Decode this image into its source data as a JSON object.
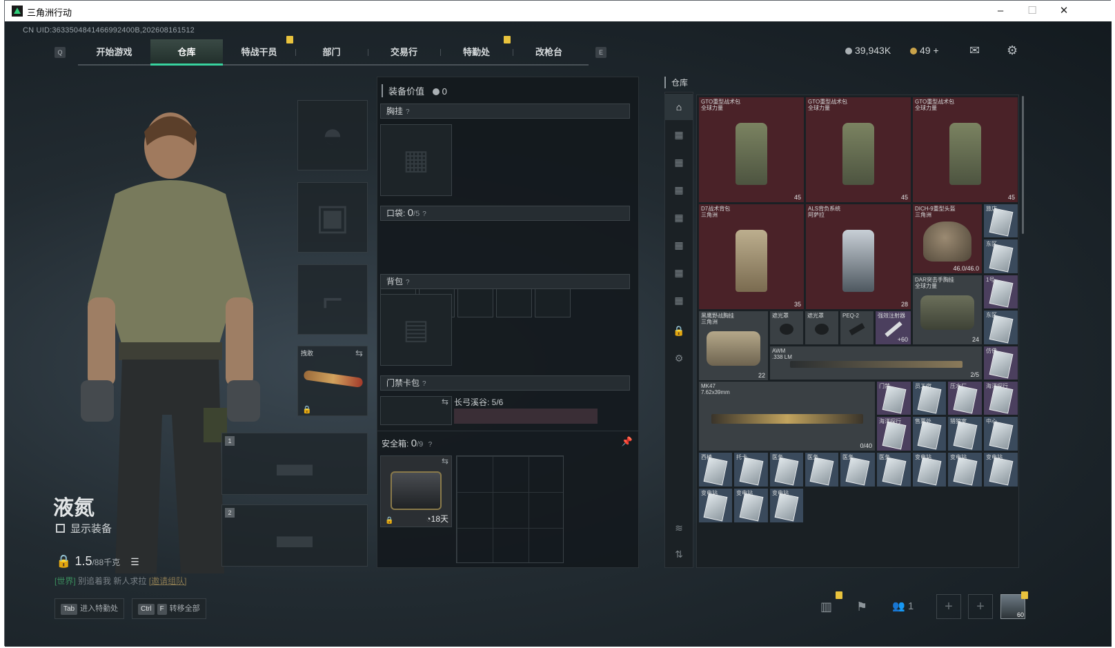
{
  "window": {
    "title": "三角洲行动",
    "minimize": "–",
    "maximize": "☐",
    "close": "✕"
  },
  "uid": "CN UID:3633504841466992400B,202608161512",
  "nav": {
    "left_key": "Q",
    "right_key": "E",
    "tabs": [
      "开始游戏",
      "仓库",
      "特战干员",
      "部门",
      "交易行",
      "特勤处",
      "改枪台"
    ],
    "active": "仓库"
  },
  "currency": {
    "silver": "39,943K",
    "gold": "49",
    "gold_add": "+"
  },
  "character": {
    "name": "液氮",
    "show_equipment": "显示装备",
    "weight": "1.5",
    "weight_max": "/88千克"
  },
  "chat": {
    "channel": "[世界]",
    "sender": "别追着我",
    "message": "新人求拉",
    "invite": "[邀请组队]"
  },
  "bottom_buttons": [
    {
      "key": "Tab",
      "label": "进入特勤处"
    },
    {
      "key": "Ctrl",
      "key2": "F",
      "label": "转移全部"
    }
  ],
  "slots": {
    "melee_label": "拽敢",
    "gun1": "1",
    "gun2": "2"
  },
  "equipment": {
    "value_label": "装备价值",
    "value": "0",
    "chest_rig": "胸挂",
    "pockets_label": "口袋:",
    "pockets_used": "0",
    "pockets_total": "/5",
    "backpack": "背包",
    "keycard": "门禁卡包",
    "keycard_map": "长弓溪谷: 5/6",
    "safe_box_label": "安全箱:",
    "safe_box_used": "0",
    "safe_box_total": "/9",
    "safe_box_timer": "18天",
    "help": "?"
  },
  "storage": {
    "title": "仓库",
    "items": [
      {
        "name": "GTO重型战术包",
        "sub": "全球力量",
        "count": "45"
      },
      {
        "name": "GTO重型战术包",
        "sub": "全球力量",
        "count": "45"
      },
      {
        "name": "GTO重型战术包",
        "sub": "全球力量",
        "count": "45"
      },
      {
        "name": "D7战术背包",
        "sub": "三角洲",
        "count": "35"
      },
      {
        "name": "ALS背负系统",
        "sub": "阿萨拉",
        "count": "28"
      },
      {
        "name": "DICH-9重型头盔",
        "sub": "三角洲",
        "count": "46.0/46.0"
      },
      {
        "name": "DAR突击手胸挂",
        "sub": "全球力量",
        "count": "24"
      },
      {
        "name": "黑鹰野战胸挂",
        "sub": "三角洲",
        "count": "22"
      },
      {
        "name": "遮光罩",
        "sub": "",
        "count": ""
      },
      {
        "name": "遮光罩",
        "sub": "",
        "count": ""
      },
      {
        "name": "PEQ-2",
        "sub": "",
        "count": ""
      },
      {
        "name": "强效注射器",
        "sub": "",
        "count": "60"
      },
      {
        "name": "AWM",
        "sub": ".338 LM",
        "count": "2/5"
      },
      {
        "name": "MK47",
        "sub": "7.62x39mm",
        "count": "0/40"
      }
    ],
    "cards": [
      "门禁",
      "员工宿",
      "压水厂",
      "海洋探行",
      "海洋探行",
      "售票处",
      "猎狼室",
      "中心",
      "西楼",
      "托卡",
      "医务",
      "医务",
      "医务",
      "医务",
      "变电站",
      "变电站",
      "变电站",
      "变电站",
      "变电站",
      "变电站",
      "东区",
      "东区",
      "1号",
      "东区",
      "仿佛",
      "旅店"
    ]
  },
  "social": {
    "friends": "1",
    "level": "60"
  },
  "colors": {
    "accent": "#38d39f",
    "badge": "#e9c33d",
    "rare_red": "#4a2228",
    "rare_purple": "#4b3f5e",
    "rare_blue": "#3a4a5c"
  }
}
